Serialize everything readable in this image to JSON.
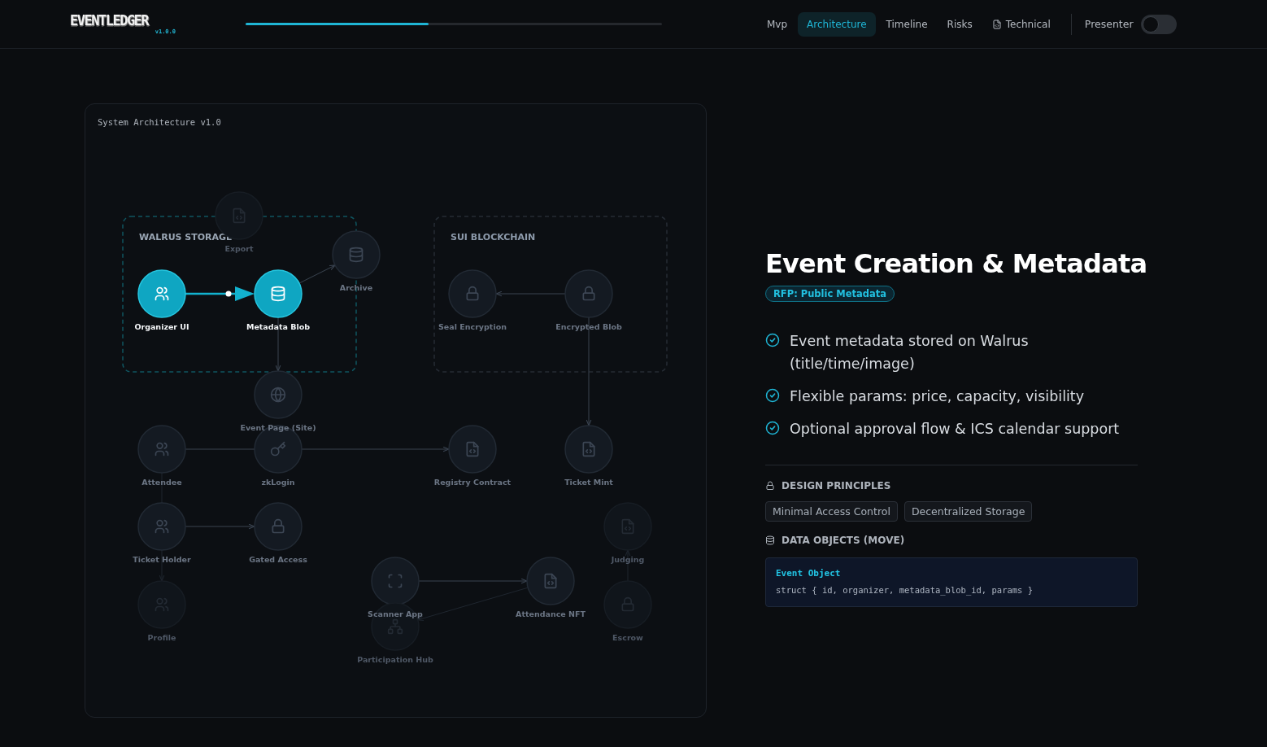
{
  "header": {
    "logo": "EVENTLEDGER",
    "version": "v1.0.0",
    "progress": {
      "level": 0.44
    },
    "tabs": [
      {
        "label": "Mvp",
        "selected": false,
        "kind": "plain"
      },
      {
        "label": "Architecture",
        "selected": true,
        "kind": "plain"
      },
      {
        "label": "Timeline",
        "selected": false,
        "kind": "plain"
      },
      {
        "label": "Risks",
        "selected": false,
        "kind": "plain"
      },
      {
        "label": "Technical",
        "selected": false,
        "kind": "document"
      }
    ],
    "presenter": {
      "label": "Presenter",
      "on": false
    }
  },
  "diagram": {
    "title": "System Architecture v1.0",
    "groups": [
      {
        "label": "WALRUS STORAGE",
        "highlighted": true
      },
      {
        "label": "SUI BLOCKCHAIN",
        "highlighted": false
      }
    ],
    "nodes": [
      {
        "label": "Export",
        "kind": "contract",
        "active": false,
        "dimmed": true
      },
      {
        "label": "Archive",
        "kind": "storage",
        "active": false,
        "dimmed": false
      },
      {
        "label": "Organizer UI",
        "kind": "user",
        "active": true,
        "dimmed": false
      },
      {
        "label": "Metadata Blob",
        "kind": "storage",
        "active": true,
        "dimmed": false
      },
      {
        "label": "Seal Encryption",
        "kind": "lock",
        "active": false,
        "dimmed": false
      },
      {
        "label": "Encrypted Blob",
        "kind": "lock",
        "active": false,
        "dimmed": false
      },
      {
        "label": "Event Page (Site)",
        "kind": "web",
        "active": false,
        "dimmed": false
      },
      {
        "label": "Attendee",
        "kind": "user",
        "active": false,
        "dimmed": false
      },
      {
        "label": "zkLogin",
        "kind": "key",
        "active": false,
        "dimmed": false
      },
      {
        "label": "Registry Contract",
        "kind": "contract",
        "active": false,
        "dimmed": false
      },
      {
        "label": "Ticket Mint",
        "kind": "contract",
        "active": false,
        "dimmed": false
      },
      {
        "label": "Ticket Holder",
        "kind": "user",
        "active": false,
        "dimmed": false
      },
      {
        "label": "Gated Access",
        "kind": "lock",
        "active": false,
        "dimmed": false
      },
      {
        "label": "Judging",
        "kind": "contract",
        "active": false,
        "dimmed": true
      },
      {
        "label": "Scanner App",
        "kind": "scanner",
        "active": false,
        "dimmed": false
      },
      {
        "label": "Attendance NFT",
        "kind": "contract",
        "active": false,
        "dimmed": false
      },
      {
        "label": "Profile",
        "kind": "user",
        "active": false,
        "dimmed": true
      },
      {
        "label": "Participation Hub",
        "kind": "hub",
        "active": false,
        "dimmed": true
      },
      {
        "label": "Escrow",
        "kind": "lock",
        "active": false,
        "dimmed": true
      }
    ]
  },
  "detail": {
    "title": "Event Creation & Metadata",
    "badge": "RFP: Public Metadata",
    "points": [
      "Event metadata stored on Walrus (title/time/image)",
      "Flexible params: price, capacity, visibility",
      "Optional approval flow & ICS calendar support"
    ],
    "principles_heading": "DESIGN PRINCIPLES",
    "principles": [
      "Minimal Access Control",
      "Decentralized Storage"
    ],
    "objects_heading": "DATA OBJECTS (MOVE)",
    "object": {
      "name": "Event Object",
      "code": "struct { id, organizer, metadata_blob_id, params }"
    }
  }
}
